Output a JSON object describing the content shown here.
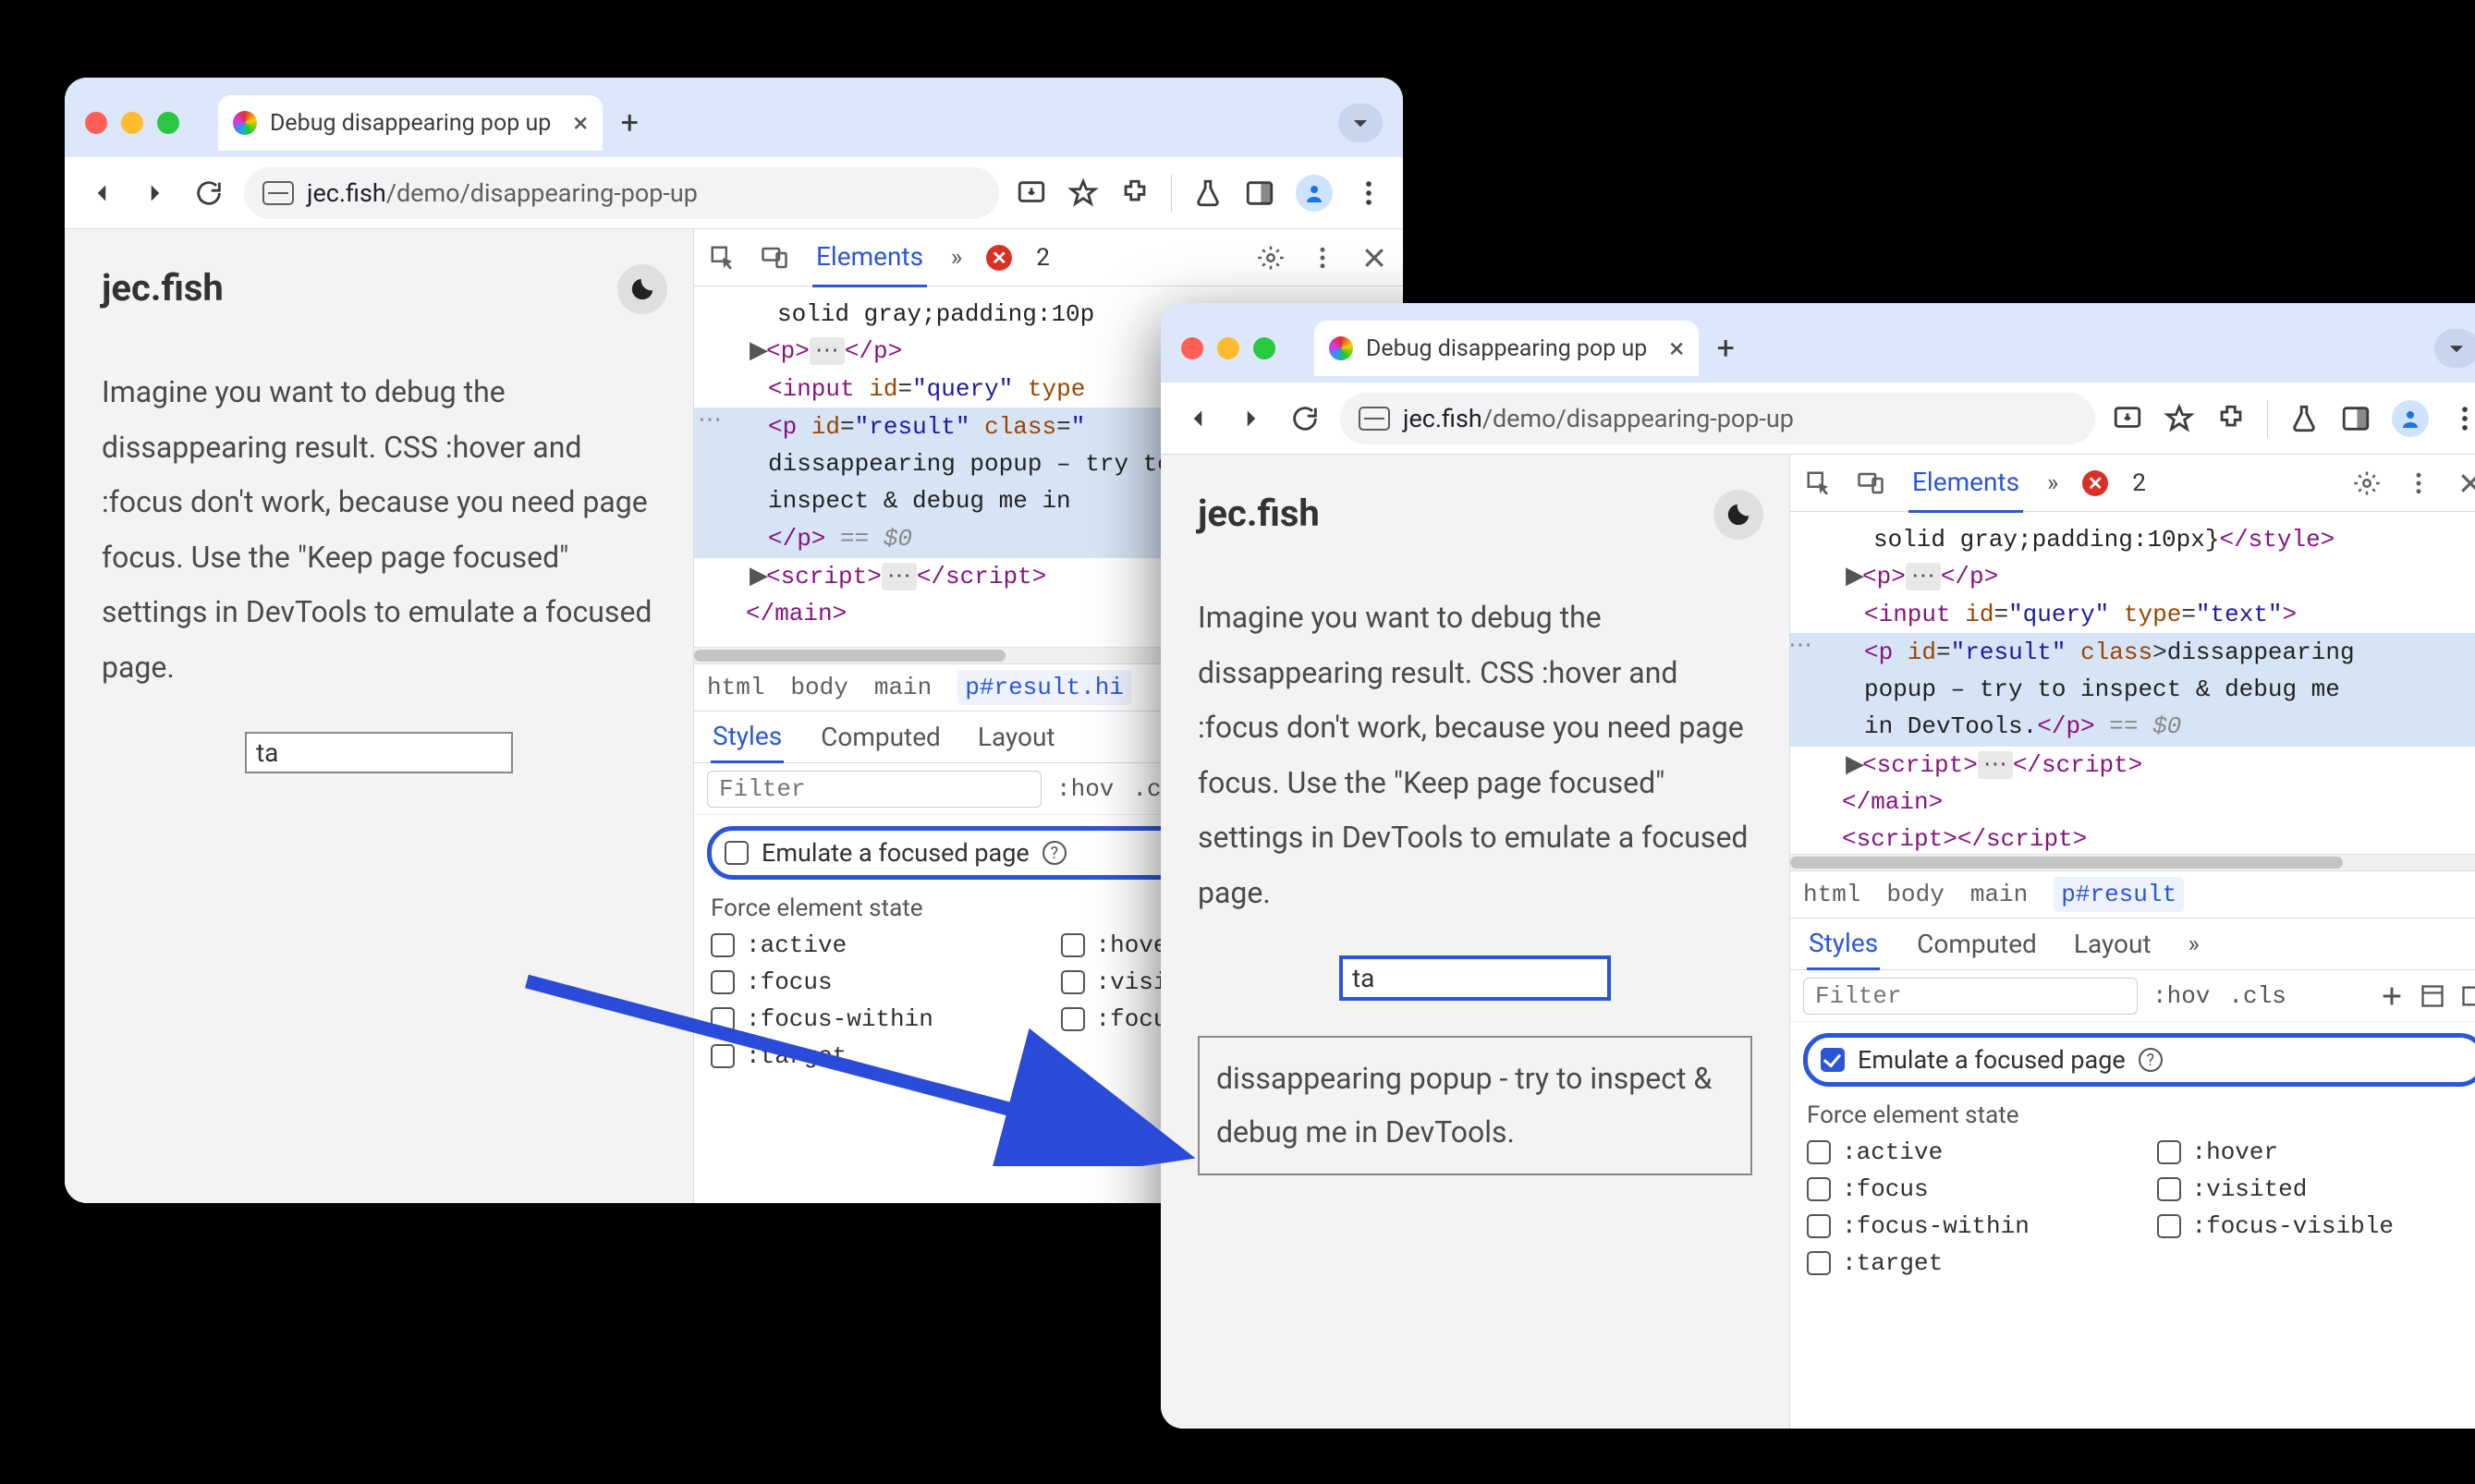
{
  "common": {
    "tab_title": "Debug disappearing pop up",
    "url_host": "jec.fish",
    "url_path": "/demo/disappearing-pop-up",
    "site_title": "jec.fish",
    "intro": "Imagine you want to debug the dissappearing result. CSS :hover and :focus don't work, because you need page focus. Use the \"Keep page focused\" settings in DevTools to emulate a focused page.",
    "input_value": "ta",
    "popup_text": "dissappearing popup - try to inspect & debug me in DevTools.",
    "elements_tab": "Elements",
    "err_count": "2",
    "crumbs": {
      "html": "html",
      "body": "body",
      "main": "main"
    },
    "styles_tabs": {
      "styles": "Styles",
      "computed": "Computed",
      "layout": "Layout"
    },
    "filter_placeholder": "Filter",
    "hov": ":hov",
    "cls": ".cls",
    "emulate_label": "Emulate a focused page",
    "force_label": "Force element state",
    "states": {
      "active": ":active",
      "hover": ":hover",
      "focus": ":focus",
      "visited": ":visited",
      "focus_within": ":focus-within",
      "focus_visible": ":focus-visible",
      "target": ":target",
      "hov_cut": ":hove",
      "visi_cut": ":visi",
      "focus_cut": ":focu"
    },
    "dom": {
      "style_text": "solid gray;padding:10p",
      "style_text_full": "solid gray;padding:10px}",
      "p1_open": "<p>",
      "p1_close": "</p>",
      "input_line_a": "<input id=",
      "input_id": "\"query\"",
      "input_type_a": " type",
      "input_line_b": "<input id=",
      "input_type_full": " type=",
      "input_type_text": "\"text\"",
      "p_result_a": "<p id=",
      "p_result_id": "\"result\"",
      "p_result_class": " class=",
      "p_result_text1": "dissappearing popup – try to ",
      "p_result_text1w": "dissappearing popup – try to inspect & debug me in DevTools.",
      "p_result_text2": "inspect & debug me in ",
      "p_close": "</p>",
      "eq0": " == $0",
      "script_open": "<script>",
      "script_close": "</script>",
      "main_close": "</main>",
      "style_close": "</style>"
    }
  },
  "left": {
    "crumb_last": "p#result.hi",
    "emulate_checked": false
  },
  "right": {
    "crumb_last": "p#result",
    "emulate_checked": true
  }
}
